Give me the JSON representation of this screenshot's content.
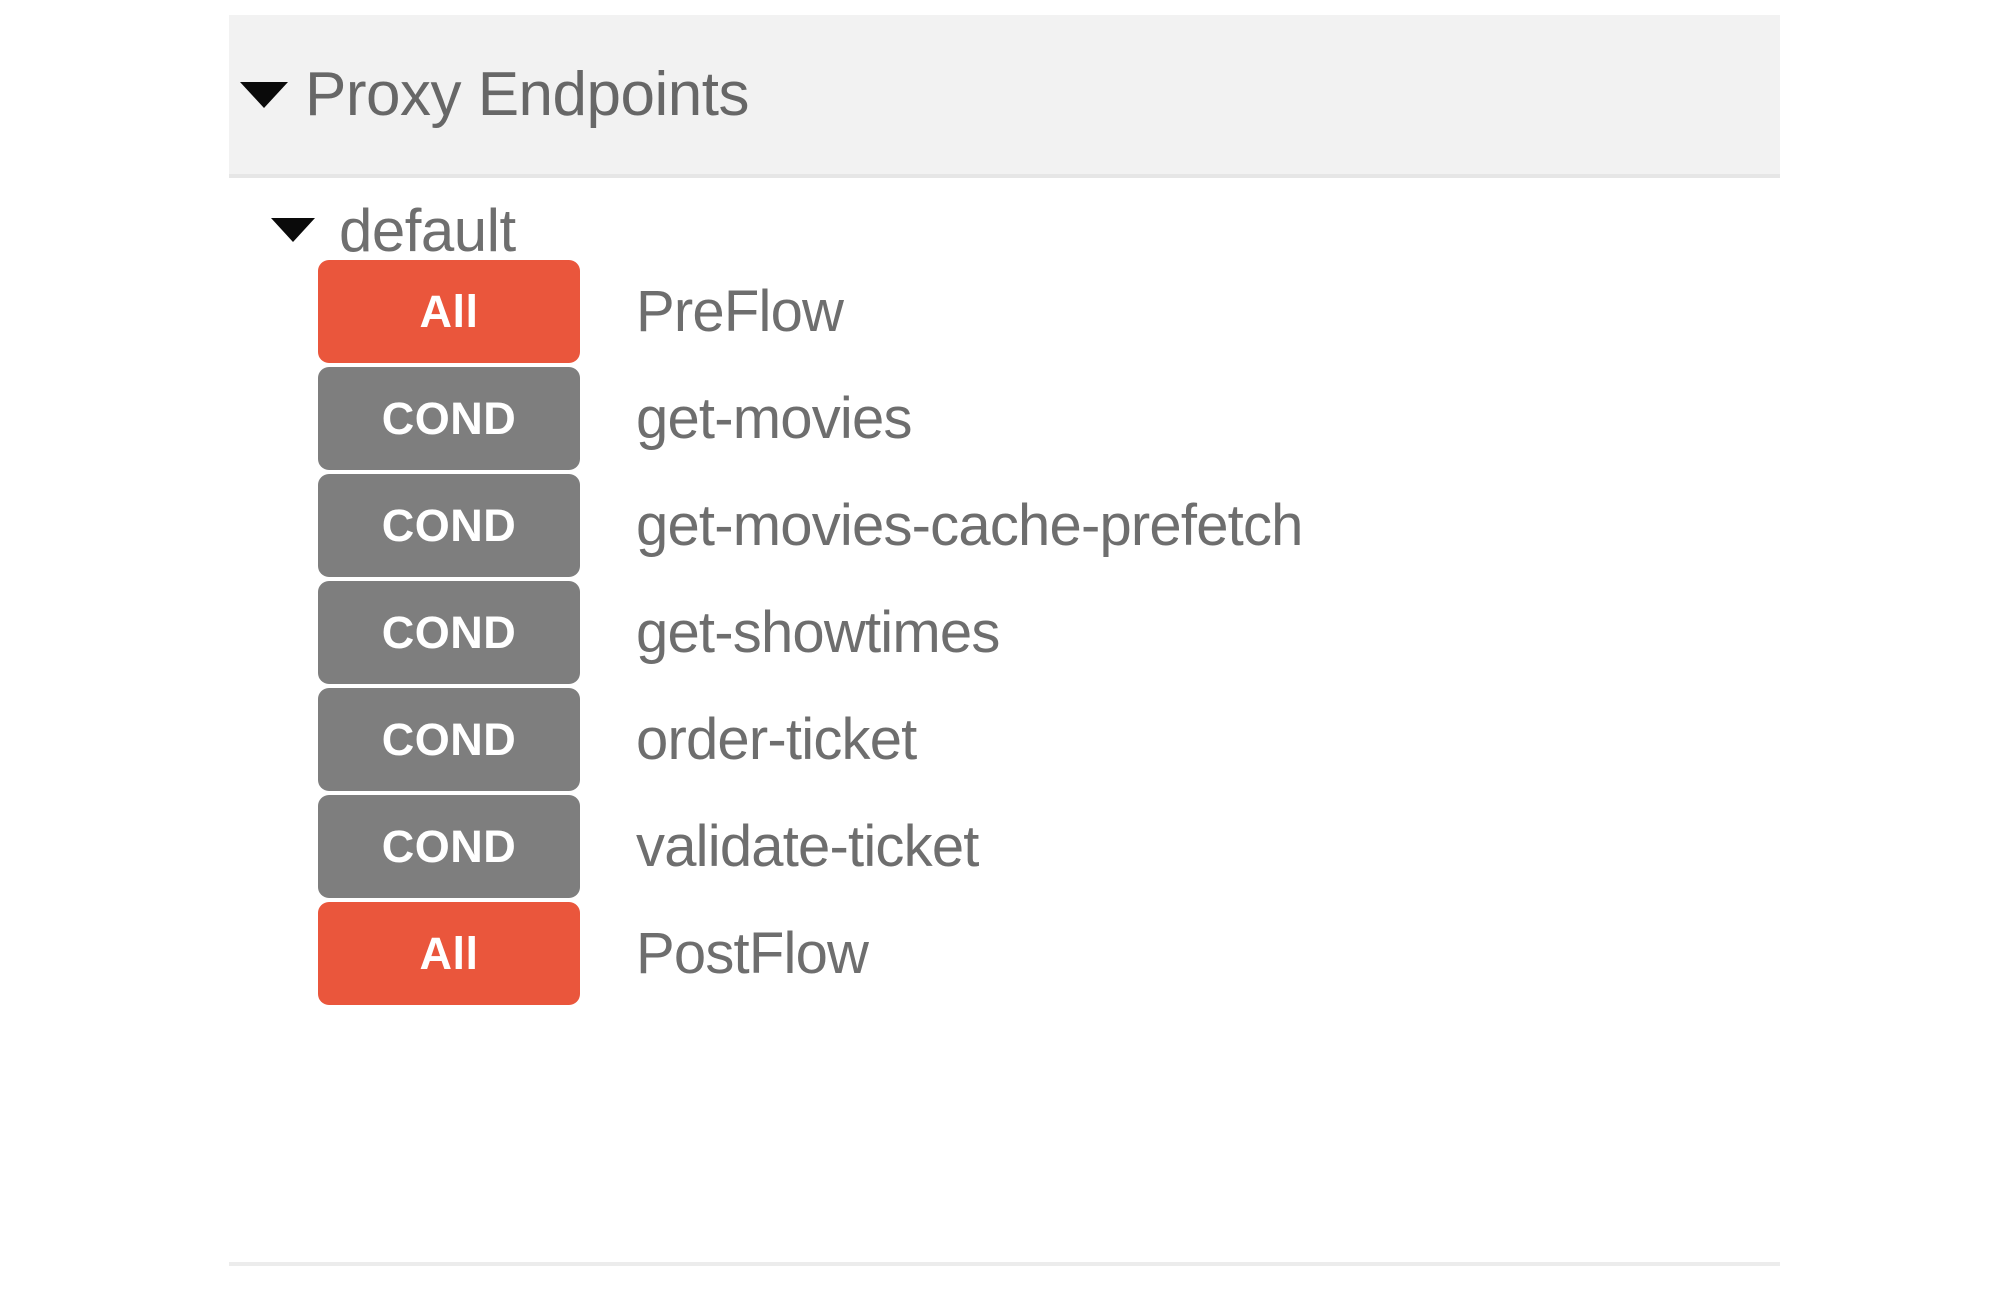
{
  "panel": {
    "section": {
      "title": "Proxy Endpoints",
      "expanded": true,
      "twisty_icon": "caret-down-icon",
      "background_color": "#f2f2f2"
    },
    "group": {
      "title": "default",
      "expanded": true,
      "twisty_icon": "caret-down-icon"
    },
    "flows": [
      {
        "badge": "All",
        "badge_type": "all",
        "badge_color": "#ea563c",
        "label": "PreFlow"
      },
      {
        "badge": "COND",
        "badge_type": "cond",
        "badge_color": "#7e7e7e",
        "label": "get-movies"
      },
      {
        "badge": "COND",
        "badge_type": "cond",
        "badge_color": "#7e7e7e",
        "label": "get-movies-cache-prefetch"
      },
      {
        "badge": "COND",
        "badge_type": "cond",
        "badge_color": "#7e7e7e",
        "label": "get-showtimes"
      },
      {
        "badge": "COND",
        "badge_type": "cond",
        "badge_color": "#7e7e7e",
        "label": "order-ticket"
      },
      {
        "badge": "COND",
        "badge_type": "cond",
        "badge_color": "#7e7e7e",
        "label": "validate-ticket"
      },
      {
        "badge": "All",
        "badge_type": "all",
        "badge_color": "#ea563c",
        "label": "PostFlow"
      }
    ]
  }
}
